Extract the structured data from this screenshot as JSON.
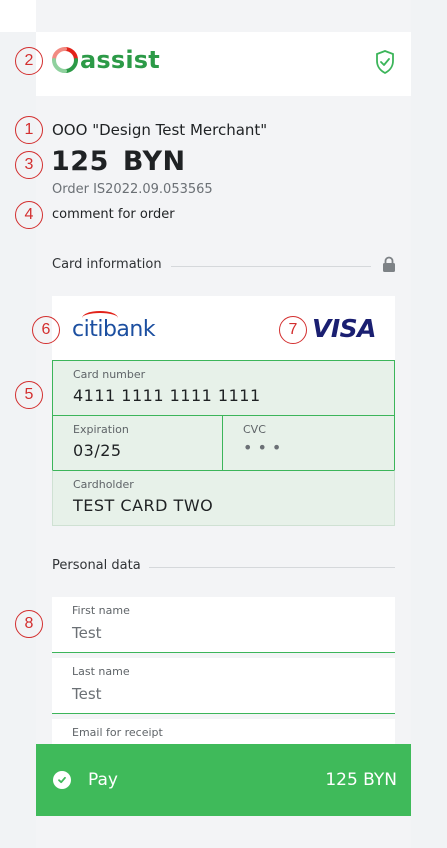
{
  "header": {
    "logo_text": "assist",
    "brand_color": "#2c9a47",
    "shield_icon": "shield-check-icon"
  },
  "merchant": {
    "name": "OOO \"Design Test Merchant\"",
    "amount": "125",
    "currency": "BYN",
    "order": "Order  IS2022.09.053565",
    "comment": "comment for order"
  },
  "card_section": {
    "title": "Card information",
    "lock_icon": "lock-icon",
    "bank_logo": "citibank",
    "bank_logo_prefix": "citi",
    "bank_logo_suffix": "bank",
    "network_logo": "VISA",
    "card_number_label": "Card number",
    "card_number": "4111  1111  1111  1111",
    "expiration_label": "Expiration",
    "expiration": "03/25",
    "cvc_label": "CVC",
    "cvc_masked": "•••",
    "cardholder_label": "Cardholder",
    "cardholder": "TEST CARD TWO",
    "field_bg": "#e7f1e9",
    "field_border": "#3cb55a"
  },
  "personal_section": {
    "title": "Personal data",
    "first_name_label": "First name",
    "first_name": "Test",
    "last_name_label": "Last name",
    "last_name": "Test",
    "email_label": "Email for receipt"
  },
  "pay": {
    "label": "Pay",
    "amount": "125 BYN",
    "color": "#3fba5a",
    "icon": "check-circle-icon"
  },
  "annotations": [
    "1",
    "2",
    "3",
    "4",
    "5",
    "6",
    "7",
    "8"
  ],
  "annotation_color": "#d32f2f"
}
